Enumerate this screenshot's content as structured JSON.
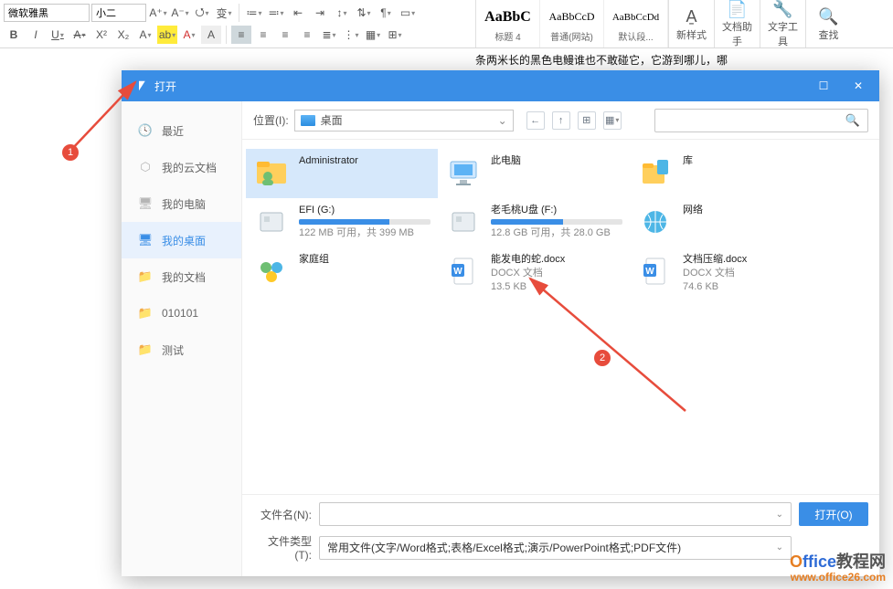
{
  "ribbon": {
    "font_name": "微软雅黑",
    "font_size": "小二",
    "grow": "A⁺",
    "shrink": "A⁻",
    "clear": "⭯",
    "highlight_g": "变",
    "bold": "B",
    "italic": "I",
    "underline": "U",
    "strike": "A",
    "sup": "X²",
    "sub": "X₂",
    "typecase": "A",
    "hl": "ab",
    "fc": "A",
    "shade": "A",
    "styles": [
      {
        "preview": "AaBbC",
        "label": "标题 4",
        "big": true
      },
      {
        "preview": "AaBbCcD",
        "label": "普通(网站)"
      },
      {
        "preview": "AaBbCcDd",
        "label": "默认段..."
      }
    ],
    "newstyle": "新样式",
    "dochelper": "文档助手",
    "texttool": "文字工具",
    "find": "查找"
  },
  "doc_snippet": "条两米长的黑色电鳗谁也不敢碰它，它游到哪儿，哪",
  "dialog": {
    "title": "打开",
    "loclabel": "位置(I):",
    "locvalue": "桌面",
    "sidebar": [
      {
        "icon": "clock",
        "label": "最近",
        "active": false
      },
      {
        "icon": "cloud",
        "label": "我的云文档",
        "active": false
      },
      {
        "icon": "pc",
        "label": "我的电脑",
        "active": false
      },
      {
        "icon": "desktop",
        "label": "我的桌面",
        "active": true
      },
      {
        "icon": "folder",
        "label": "我的文档",
        "active": false
      },
      {
        "icon": "folder",
        "label": "010101",
        "active": false
      },
      {
        "icon": "folder",
        "label": "测试",
        "active": false
      }
    ],
    "items": {
      "admin": "Administrator",
      "thispc": "此电脑",
      "lib": "库",
      "efi_name": "EFI (G:)",
      "efi_sub": "122 MB 可用，共 399 MB",
      "efi_pct": 69,
      "usb_name": "老毛桃U盘 (F:)",
      "usb_sub": "12.8 GB 可用，共 28.0 GB",
      "usb_pct": 55,
      "net": "网络",
      "home": "家庭组",
      "docx1_name": "能发电的蛇.docx",
      "docx1_type": "DOCX 文档",
      "docx1_size": "13.5 KB",
      "docx2_name": "文档压缩.docx",
      "docx2_type": "DOCX 文档",
      "docx2_size": "74.6 KB"
    },
    "footer": {
      "fname_label": "文件名(N):",
      "fname_value": "",
      "ftype_label": "文件类型(T):",
      "ftype_value": "常用文件(文字/Word格式;表格/Excel格式;演示/PowerPoint格式;PDF文件)",
      "open_btn": "打开(O)"
    }
  },
  "annot": {
    "one": "1",
    "two": "2"
  },
  "watermark": {
    "brand": "Office教程网",
    "url": "www.office26.com"
  }
}
